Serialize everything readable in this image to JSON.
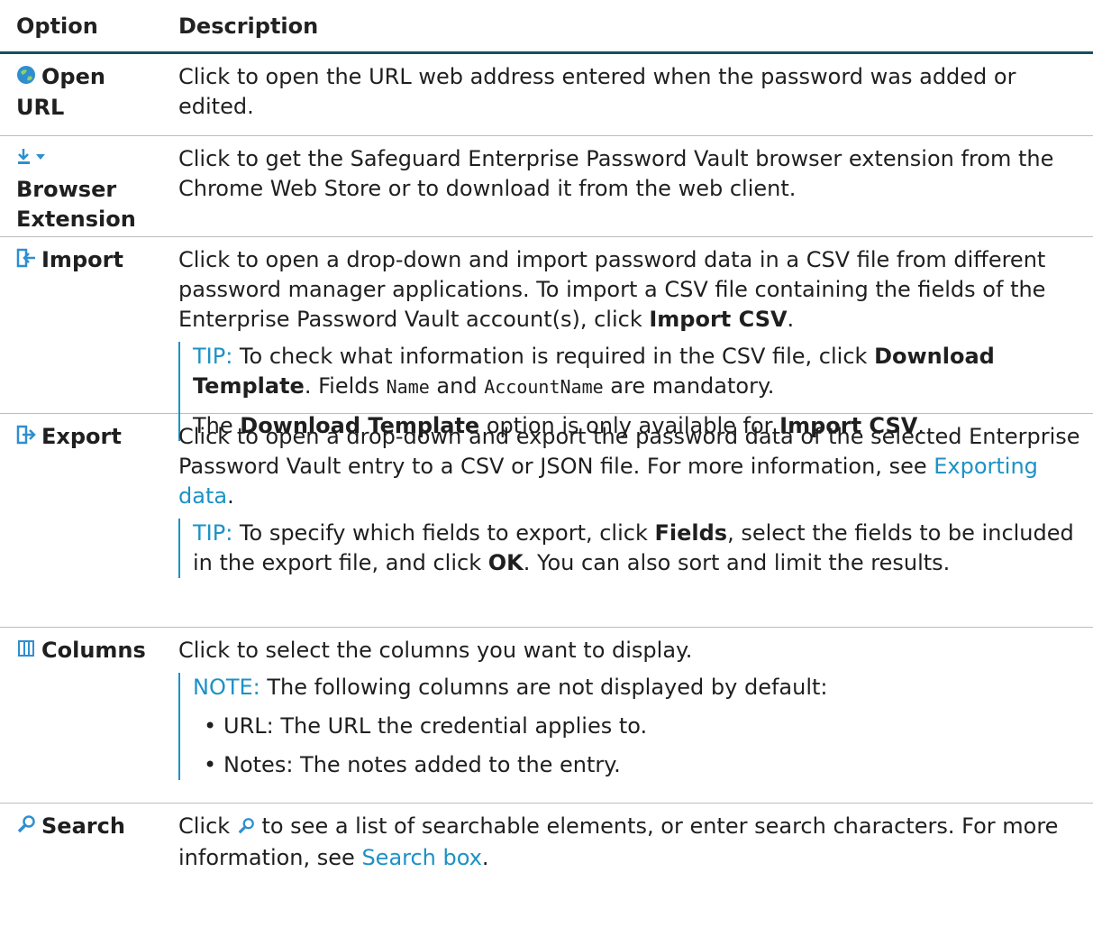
{
  "header": {
    "option": "Option",
    "description": "Description"
  },
  "rows": {
    "open_url": {
      "label_a": "Open",
      "label_b": "URL",
      "icon": "globe-icon",
      "desc": "Click to open the URL web address entered when the password was added or edited."
    },
    "browser_ext": {
      "label_a": "Browser",
      "label_b": "Extension",
      "icon": "download-arrow-icon",
      "desc": "Click to get the Safeguard Enterprise Password Vault browser extension from the Chrome Web Store or to download it from the web client."
    },
    "import": {
      "label": "Import",
      "icon": "import-icon",
      "desc_pre": "Click to open a drop-down and import password data in a CSV file from different password manager applications. To import a CSV file containing the fields of the Enterprise Password Vault account(s), click ",
      "desc_bold": "Import CSV",
      "desc_post": ".",
      "tip_label": "TIP:",
      "tip_pre": " To check what information is required in the CSV file, click ",
      "tip_bold": "Download Template",
      "tip_mid": ". Fields ",
      "tip_code1": "Name",
      "tip_and": " and ",
      "tip_code2": "AccountName",
      "tip_post": " are mandatory.",
      "note2_pre": "The ",
      "note2_bold1": "Download Template",
      "note2_mid": " option is only available for ",
      "note2_bold2": "Import CSV",
      "note2_post": "."
    },
    "export": {
      "label": "Export",
      "icon": "export-icon",
      "desc_pre": "Click to open a drop-down and export the password data of the selected Enterprise Password Vault entry to a CSV or JSON file. For more information, see ",
      "desc_link": "Exporting data",
      "desc_post": ".",
      "tip_label": "TIP:",
      "tip_pre": " To specify which fields to export, click ",
      "tip_bold1": "Fields",
      "tip_mid": ", select the fields to be included in the export file, and click ",
      "tip_bold2": "OK",
      "tip_post": ". You can also sort and limit the results."
    },
    "columns": {
      "label": "Columns",
      "icon": "columns-icon",
      "desc": "Click to select the columns you want to display.",
      "note_label": "NOTE:",
      "note_text": " The following columns are not displayed by default:",
      "bullets": [
        "URL: The URL the credential applies to.",
        "Notes: The notes added to the entry."
      ]
    },
    "search": {
      "label": "Search",
      "icon": "magnifier-icon",
      "desc_pre": "Click ",
      "desc_mid": " to see a list of searchable elements, or enter search characters. For more information, see ",
      "desc_link": "Search box",
      "desc_post": "."
    }
  },
  "colors": {
    "accent": "#1c92c5",
    "header_rule": "#14505f",
    "row_rule": "#bdbdbd"
  }
}
